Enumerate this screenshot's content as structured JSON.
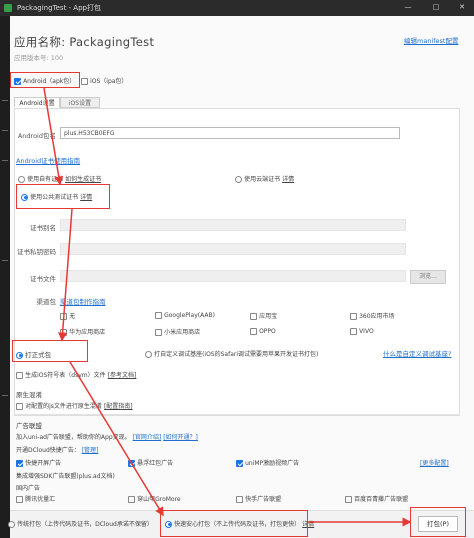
{
  "window": {
    "title": "PackagingTest - App打包",
    "min": "—",
    "max": "□",
    "close": "✕"
  },
  "header": {
    "app_name": "应用名称: PackagingTest",
    "app_version": "应用版本号: 100",
    "edit_manifest": "编辑manifest配置"
  },
  "platforms": {
    "android": "Android（apk包）",
    "ios": "iOS（ipa包）",
    "android_checked": true,
    "ios_checked": false
  },
  "tabs": {
    "android": "Android设置",
    "ios": "iOS设置"
  },
  "android": {
    "package_label": "Android包名",
    "package_value": "plus.H53CB0EFG",
    "cert_link": "Android证书使用指南",
    "cert_options": {
      "own": "使用自有证书",
      "how": "如何生成证书",
      "cloud": "使用云端证书",
      "cloud_detail": "详情",
      "public": "使用公共测试证书",
      "public_detail": "详情"
    },
    "alias_label": "证书别名",
    "privkey_label": "证书私钥密码",
    "file_label": "证书文件",
    "browse": "浏览...",
    "channel_label": "渠道包",
    "channel_link": "渠道包制作指南",
    "channels": [
      "无",
      "GooglePlay(AAB)",
      "应用宝",
      "360应用市场",
      "华为应用商店",
      "小米应用商店",
      "OPPO",
      "VIVO"
    ]
  },
  "build": {
    "formal": "打正式包",
    "custom": "打自定义调试基座(iOS的Safari调试需要用苹果开发证书打包)",
    "custom_link": "什么是自定义调试基座?",
    "dsym_prefix": "生成iOS符号表（dsym）文件",
    "dsym_link": "[参考文档]"
  },
  "native_obfuscation": {
    "title": "原生混淆",
    "desc": "对配置的js文件进行原生混淆",
    "guide": "[配置指南]"
  },
  "ads": {
    "title": "广告联盟",
    "desc": "加入uni-ad广告联盟，帮助你的App变现。",
    "official": "[官网介绍]",
    "apply": "[如何开通？]",
    "dcloud_prefix": "开通DCloud快捷广告：",
    "manage": "[管理]",
    "row1": [
      "快捷开屏广告",
      "悬浮红包广告",
      "uniMP激励视频广告"
    ],
    "more": "[更多配置]",
    "sdk_title": "集成增强SDK广告联盟(plus.ad文档)",
    "domestic_title": "国内广告",
    "domestic": [
      "腾讯优量汇",
      "穿山甲GroMore",
      "快手广告联盟",
      "百度百青藤广告联盟"
    ]
  },
  "bottom": {
    "traditional": "传统打包（上传代码及证书，DCloud承诺不保留）",
    "fast": "快速安心打包（不上传代码及证书，打包更快）",
    "detail": "详情",
    "pack_button": "打包(P)"
  },
  "colors": {
    "accent": "#1a73e8",
    "highlight": "#e53935",
    "link": "#1e6fd0"
  }
}
